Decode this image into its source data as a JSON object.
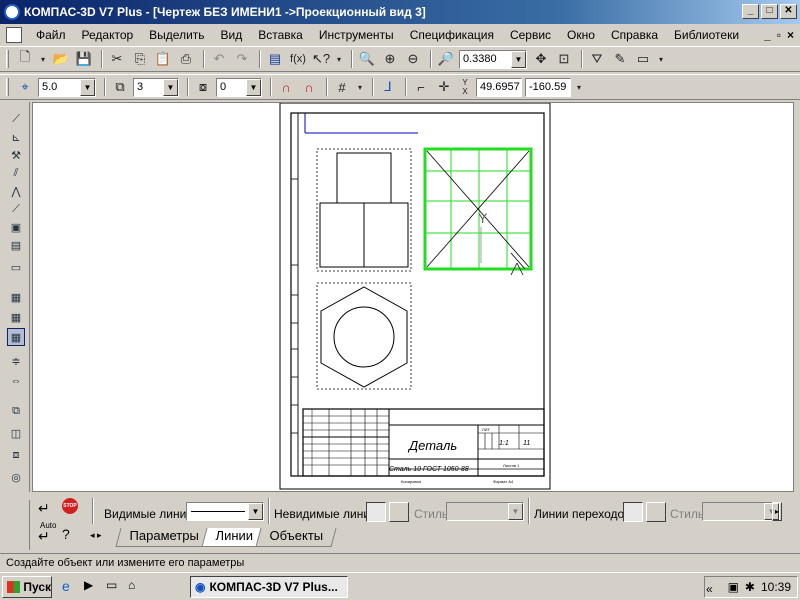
{
  "window": {
    "title": "КОМПАС-3D V7 Plus - [Чертеж БЕЗ ИМЕНИ1 ->Проекционный вид 3]",
    "buttons": [
      "_",
      "□",
      "✕"
    ]
  },
  "menu": {
    "items": [
      "Файл",
      "Редактор",
      "Выделить",
      "Вид",
      "Вставка",
      "Инструменты",
      "Спецификация",
      "Сервис",
      "Окно",
      "Справка",
      "Библиотеки"
    ],
    "mdi_buttons": [
      "_",
      "▫",
      "×"
    ]
  },
  "toolbar1": {
    "zoom_value": "0.3380"
  },
  "toolbar2": {
    "step_value": "5.0",
    "layer_value": "3",
    "angle_value": "0",
    "coord_x": "49.6957",
    "coord_y": "-160.59"
  },
  "drawing": {
    "title_block": {
      "part_name": "Деталь",
      "material": "Сталь 10  ГОСТ 1050-88",
      "scale": "1:1",
      "mass": "",
      "sheet_label": "Листов  1",
      "format": "Формат  А4",
      "copied": "Копировал",
      "sheet_num_small": "ЛИТ",
      "sheets_count": "11"
    },
    "view_label": "Y"
  },
  "property_panel": {
    "visible_lines_label": "Видимые линии",
    "hidden_lines_label": "Невидимые линии",
    "style_label_1": "Стиль",
    "transition_lines_label": "Линии переходов",
    "style_label_2": "Стиль",
    "auto_label": "Auto",
    "stop_label": "STOP",
    "tabs": [
      "Параметры",
      "Линии",
      "Объекты"
    ]
  },
  "status": {
    "text": "Создайте объект или измените его параметры"
  },
  "taskbar": {
    "start_label": "Пуск",
    "app_label": "КОМПАС-3D V7 Plus...",
    "tray_chevron": "«",
    "time": "10:39"
  }
}
